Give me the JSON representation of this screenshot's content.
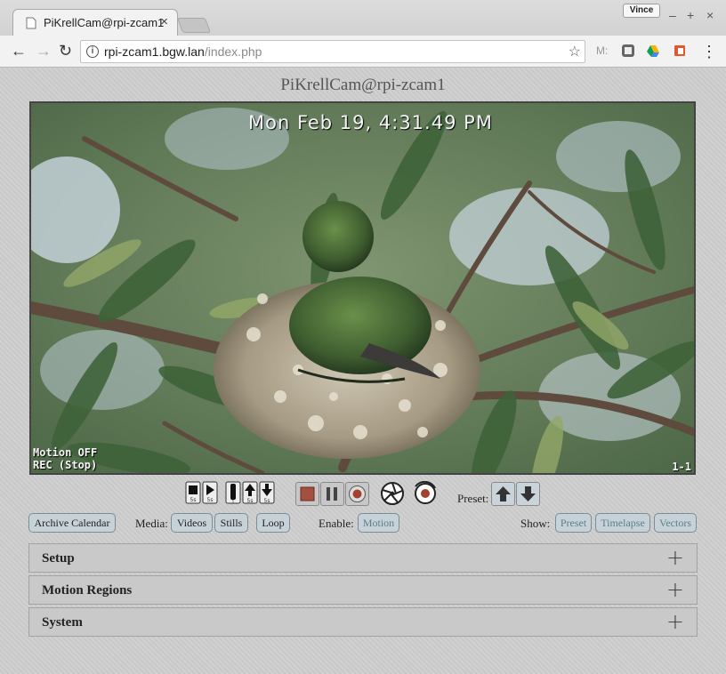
{
  "browser": {
    "tab_title": "PiKrellCam@rpi-zcam1",
    "tab_close": "×",
    "profile": "Vince",
    "minimize": "–",
    "maximize": "+",
    "close": "×",
    "back": "←",
    "forward": "→",
    "reload": "↻",
    "url_host": "rpi-zcam1.bgw.lan",
    "url_path": "/index.php",
    "star": "☆",
    "ext_mail": "M:",
    "menu": "⋮"
  },
  "page": {
    "title": "PiKrellCam@rpi-zcam1"
  },
  "camera": {
    "timestamp": "Mon Feb 19,   4:31.49 PM",
    "motion_status": "Motion OFF",
    "rec_status": "REC (Stop)",
    "index": "1-1"
  },
  "controls": {
    "preset_label": "Preset:"
  },
  "buttons": {
    "archive_calendar": "Archive Calendar",
    "media_label": "Media:",
    "videos": "Videos",
    "stills": "Stills",
    "loop": "Loop",
    "enable_label": "Enable:",
    "motion": "Motion",
    "show_label": "Show:",
    "preset": "Preset",
    "timelapse": "Timelapse",
    "vectors": "Vectors"
  },
  "sections": [
    {
      "title": "Setup",
      "icon": "+"
    },
    {
      "title": "Motion Regions",
      "icon": "+"
    },
    {
      "title": "System",
      "icon": "+"
    }
  ]
}
